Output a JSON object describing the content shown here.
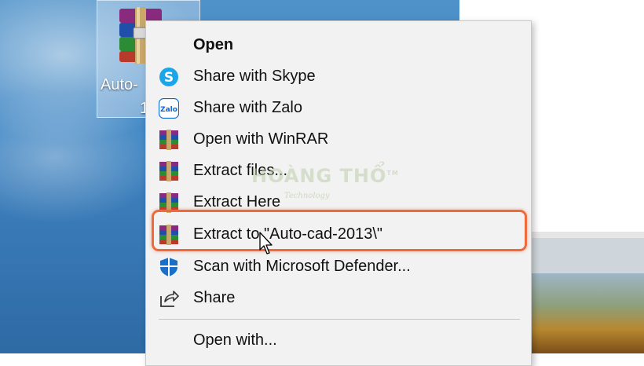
{
  "desktop": {
    "icon_label_line1": "Auto-",
    "icon_label_line2": "1"
  },
  "context_menu": {
    "items": [
      {
        "label": "Open",
        "icon": "none"
      },
      {
        "label": "Share with Skype",
        "icon": "skype-icon"
      },
      {
        "label": "Share with Zalo",
        "icon": "zalo-icon"
      },
      {
        "label": "Open with WinRAR",
        "icon": "winrar-icon"
      },
      {
        "label": "Extract files...",
        "icon": "winrar-icon"
      },
      {
        "label": "Extract Here",
        "icon": "winrar-icon"
      },
      {
        "label": "Extract to \"Auto-cad-2013\\\"",
        "icon": "winrar-icon"
      },
      {
        "label": "Scan with Microsoft Defender...",
        "icon": "defender-shield-icon"
      },
      {
        "label": "Share",
        "icon": "share-icon"
      },
      {
        "label": "Open with...",
        "icon": "none"
      }
    ],
    "highlighted_index": 6,
    "highlight_color": "#ee6a3a"
  },
  "watermark": {
    "brand": "HOÀNG THỔ",
    "tagline": "Technology",
    "tm": "TM"
  },
  "colors": {
    "menu_bg": "#f2f2f2",
    "skype_blue": "#1aa6e8",
    "zalo_blue": "#0b68d6",
    "defender_blue": "#1a6fc8"
  }
}
